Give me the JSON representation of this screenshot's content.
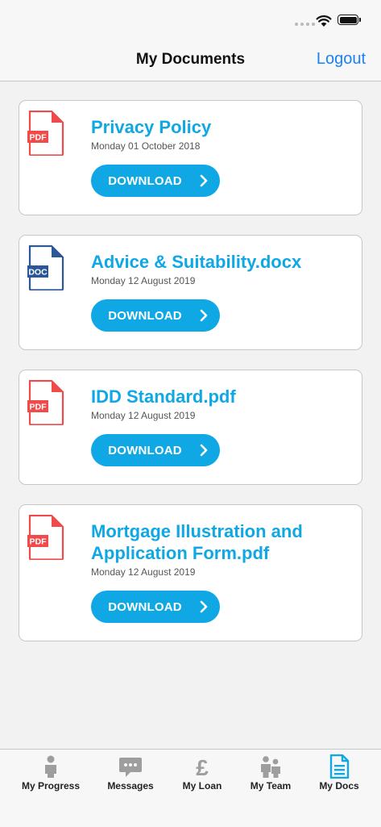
{
  "nav": {
    "title": "My Documents",
    "logout_label": "Logout"
  },
  "documents": [
    {
      "title": "Privacy Policy",
      "date": "Monday 01 October 2018",
      "type": "PDF",
      "button_label": "DOWNLOAD"
    },
    {
      "title": "Advice & Suitability.docx",
      "date": "Monday 12 August 2019",
      "type": "DOC",
      "button_label": "DOWNLOAD"
    },
    {
      "title": "IDD Standard.pdf",
      "date": "Monday 12 August 2019",
      "type": "PDF",
      "button_label": "DOWNLOAD"
    },
    {
      "title": "Mortgage Illustration and Application Form.pdf",
      "date": "Monday 12 August 2019",
      "type": "PDF",
      "button_label": "DOWNLOAD"
    }
  ],
  "tabs": [
    {
      "label": "My Progress",
      "icon": "person-icon",
      "active": false
    },
    {
      "label": "Messages",
      "icon": "chat-bubble-icon",
      "active": false
    },
    {
      "label": "My Loan",
      "icon": "pound-icon",
      "active": false
    },
    {
      "label": "My Team",
      "icon": "team-icon",
      "active": false
    },
    {
      "label": "My Docs",
      "icon": "document-icon",
      "active": true
    }
  ],
  "colors": {
    "accent": "#0fa8e4",
    "link": "#1a82f7",
    "pdf": "#ef4b4b",
    "doc": "#2b5797",
    "tab_inactive": "#9e9e9e"
  }
}
